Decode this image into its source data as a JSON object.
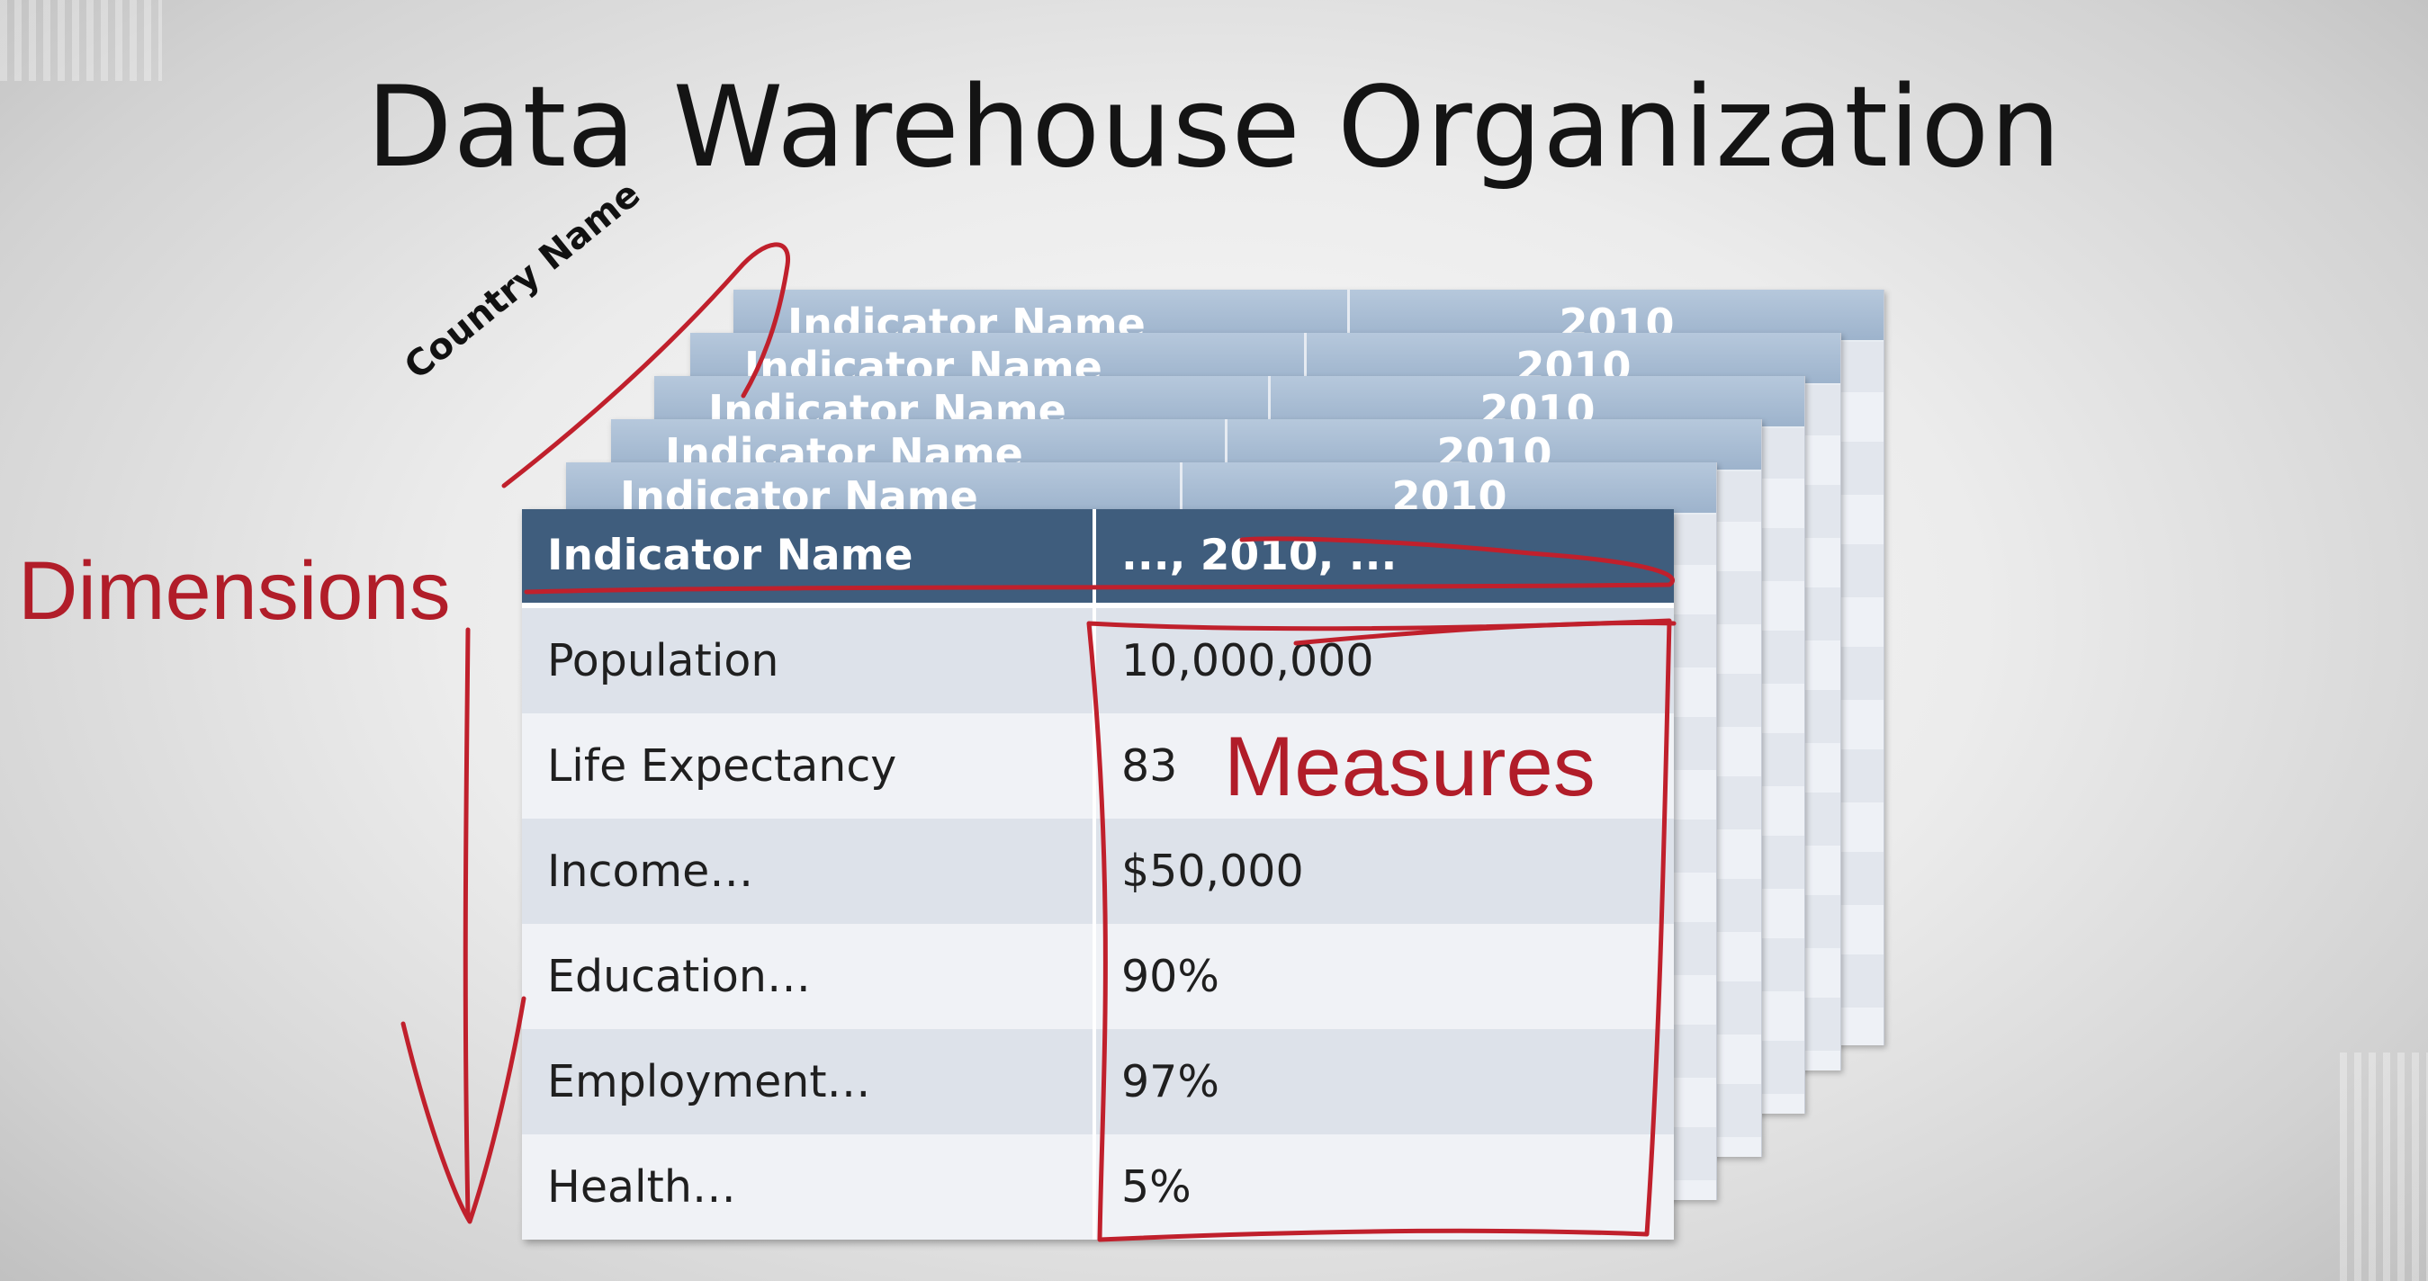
{
  "title": "Data Warehouse Organization",
  "annotations": {
    "country": "Country Name",
    "dimensions": "Dimensions",
    "measures": "Measures"
  },
  "back_sheet": {
    "col1": "Indicator Name",
    "col2": "2010"
  },
  "table": {
    "headers": [
      "Indicator Name",
      "..., 2010, ..."
    ],
    "rows": [
      [
        "Population",
        "10,000,000"
      ],
      [
        "Life Expectancy",
        "83"
      ],
      [
        "Income…",
        "$50,000"
      ],
      [
        "Education…",
        "90%"
      ],
      [
        "Employment…",
        "97%"
      ],
      [
        "Health…",
        "5%"
      ]
    ]
  },
  "colors": {
    "ink": "#b11d29",
    "header": "#3f5d7d",
    "back_header": "#9db3cc"
  }
}
